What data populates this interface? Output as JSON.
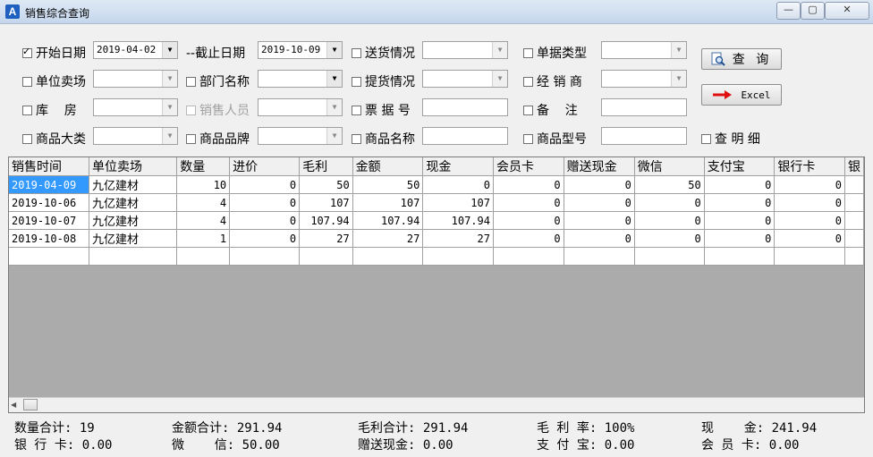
{
  "window": {
    "title": "销售综合查询",
    "min": "—",
    "max": "▢",
    "close": "✕"
  },
  "filters": {
    "start_date": {
      "label": "开始日期",
      "value": "2019-04-02",
      "checked": true
    },
    "end_date": {
      "label": "--截止日期",
      "value": "2019-10-09"
    },
    "delivery": {
      "label": "送货情况"
    },
    "doc_type": {
      "label": "单据类型"
    },
    "store": {
      "label": "单位卖场"
    },
    "department": {
      "label": "部门名称"
    },
    "pickup": {
      "label": "提货情况"
    },
    "dealer": {
      "label": "经 销 商"
    },
    "warehouse": {
      "label": "库    房"
    },
    "salesperson": {
      "label": "销售人员"
    },
    "ticket_no": {
      "label": "票 据 号"
    },
    "remark": {
      "label": "备    注"
    },
    "category": {
      "label": "商品大类"
    },
    "brand": {
      "label": "商品品牌"
    },
    "product_name": {
      "label": "商品名称"
    },
    "model": {
      "label": "商品型号"
    },
    "detail": {
      "label": "查 明 细"
    }
  },
  "buttons": {
    "query": "查 询",
    "excel": "Excel"
  },
  "table": {
    "columns": [
      "销售时间",
      "单位卖场",
      "数量",
      "进价",
      "毛利",
      "金额",
      "现金",
      "会员卡",
      "赠送现金",
      "微信",
      "支付宝",
      "银行卡",
      "银"
    ],
    "rows": [
      [
        "2019-04-09",
        "九亿建材",
        "10",
        "0",
        "50",
        "50",
        "0",
        "0",
        "0",
        "50",
        "0",
        "0"
      ],
      [
        "2019-10-06",
        "九亿建材",
        "4",
        "0",
        "107",
        "107",
        "107",
        "0",
        "0",
        "0",
        "0",
        "0"
      ],
      [
        "2019-10-07",
        "九亿建材",
        "4",
        "0",
        "107.94",
        "107.94",
        "107.94",
        "0",
        "0",
        "0",
        "0",
        "0"
      ],
      [
        "2019-10-08",
        "九亿建材",
        "1",
        "0",
        "27",
        "27",
        "27",
        "0",
        "0",
        "0",
        "0",
        "0"
      ]
    ]
  },
  "summary": {
    "qty": "数量合计: 19",
    "amount": "金额合计: 291.94",
    "profit": "毛利合计: 291.94",
    "margin": "毛 利 率: 100%",
    "cash": "现    金: 241.94",
    "bank": "银 行 卡: 0.00",
    "wechat": "微    信: 50.00",
    "gift": "赠送现金: 0.00",
    "alipay": "支 付 宝: 0.00",
    "member": "会 员 卡: 0.00"
  }
}
